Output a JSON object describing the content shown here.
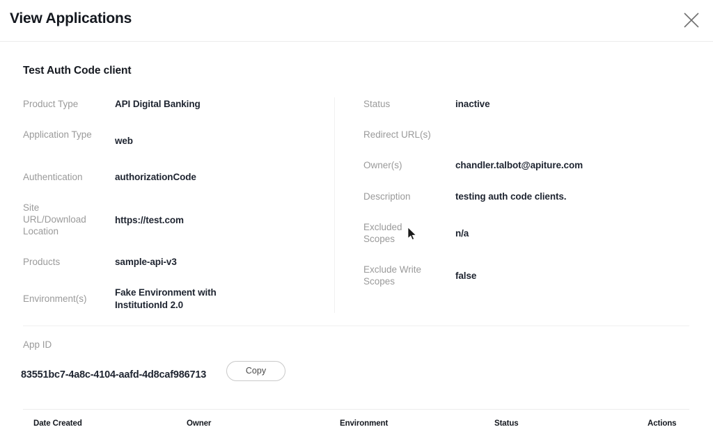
{
  "header": {
    "title": "View Applications",
    "close_icon": "close-icon"
  },
  "client": {
    "name": "Test Auth Code client"
  },
  "details": {
    "left_column": [
      {
        "label": "Product Type",
        "value": "API Digital Banking"
      },
      {
        "label": "Application Type",
        "value": "web"
      },
      {
        "label": "Authentication",
        "value": "authorizationCode"
      },
      {
        "label": "Site URL/Download Location",
        "value": "https://test.com"
      },
      {
        "label": "Products",
        "value": "sample-api-v3"
      },
      {
        "label": "Environment(s)",
        "value": "Fake Environment with InstitutionId 2.0"
      }
    ],
    "right_column": [
      {
        "label": "Status",
        "value": "inactive"
      },
      {
        "label": "Redirect URL(s)",
        "value": ""
      },
      {
        "label": "Owner(s)",
        "value": "chandler.talbot@apiture.com"
      },
      {
        "label": "Description",
        "value": "testing auth code clients."
      },
      {
        "label": "Excluded Scopes",
        "value": "n/a"
      },
      {
        "label": "Exclude Write Scopes",
        "value": "false"
      }
    ]
  },
  "app_id": {
    "label": "App ID",
    "value": "83551bc7-4a8c-4104-aafd-4d8caf986713",
    "copy_label": "Copy"
  },
  "table": {
    "columns": [
      "Date Created",
      "Owner",
      "Environment",
      "Status",
      "Actions"
    ]
  },
  "colors": {
    "label": "#9a9a9a",
    "value": "#1e2430",
    "divider": "#ececec",
    "background": "#ffffff"
  }
}
